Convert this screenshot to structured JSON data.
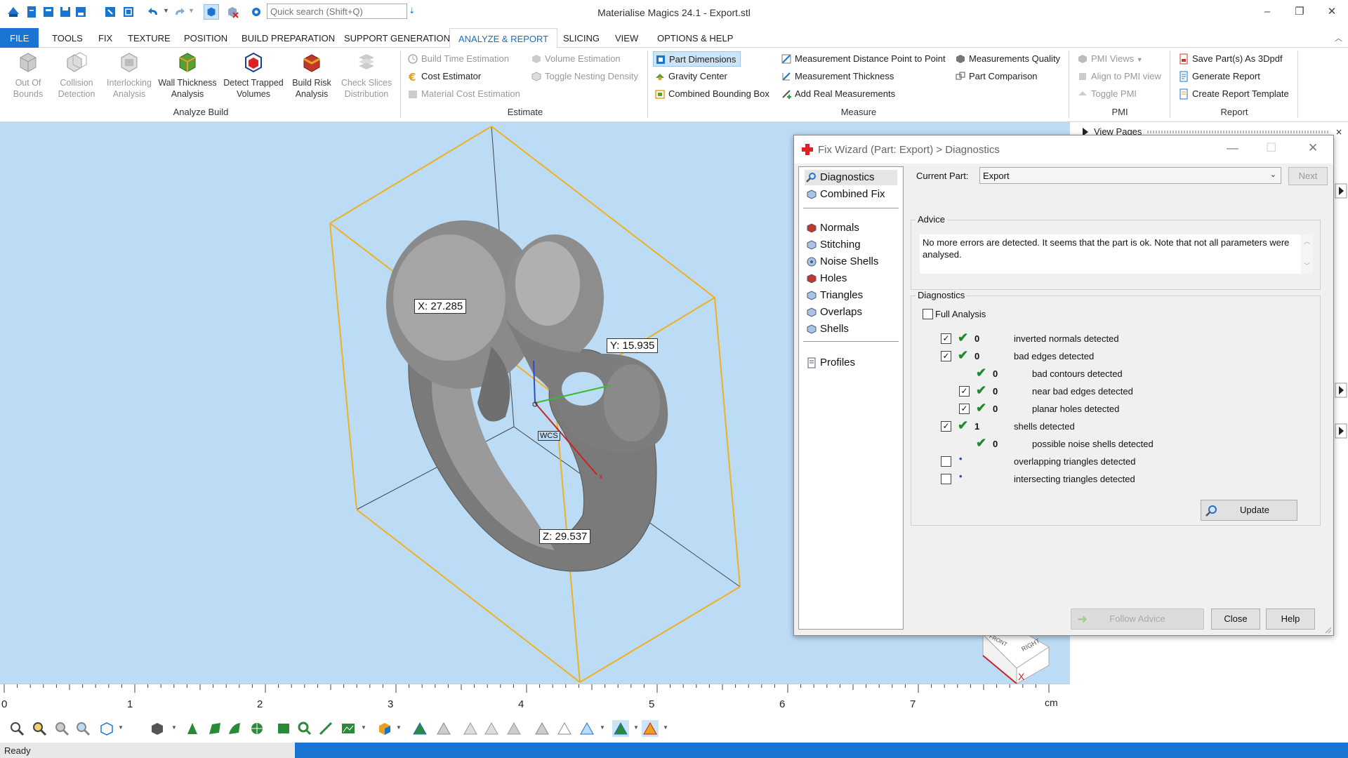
{
  "window": {
    "title": "Materialise Magics 24.1 - Export.stl",
    "search_placeholder": "Quick search (Shift+Q)",
    "minimize": "–",
    "restore": "❐",
    "close": "✕"
  },
  "menu": {
    "tabs": [
      "FILE",
      "TOOLS",
      "FIX",
      "TEXTURE",
      "POSITION",
      "BUILD PREPARATION",
      "SUPPORT GENERATION",
      "ANALYZE & REPORT",
      "SLICING",
      "VIEW",
      "OPTIONS & HELP"
    ],
    "active": "ANALYZE & REPORT"
  },
  "ribbon": {
    "analyze_build": {
      "label": "Analyze Build",
      "buttons": [
        {
          "line1": "Out Of",
          "line2": "Bounds",
          "enabled": false
        },
        {
          "line1": "Collision",
          "line2": "Detection",
          "enabled": false
        },
        {
          "line1": "Interlocking",
          "line2": "Analysis",
          "enabled": false
        },
        {
          "line1": "Wall Thickness",
          "line2": "Analysis",
          "enabled": true
        },
        {
          "line1": "Detect Trapped",
          "line2": "Volumes",
          "enabled": true
        },
        {
          "line1": "Build Risk",
          "line2": "Analysis",
          "enabled": true
        },
        {
          "line1": "Check Slices",
          "line2": "Distribution",
          "enabled": false
        }
      ]
    },
    "estimate": {
      "label": "Estimate",
      "col1": [
        "Build Time Estimation",
        "Cost Estimator",
        "Material Cost Estimation"
      ],
      "col2": [
        "Volume Estimation",
        "Toggle Nesting Density"
      ]
    },
    "measure": {
      "label": "Measure",
      "col1": [
        "Part Dimensions",
        "Gravity Center",
        "Combined Bounding Box"
      ],
      "col2": [
        "Measurement Distance Point to Point",
        "Measurement Thickness",
        "Add Real Measurements"
      ],
      "col3": [
        "Measurements Quality",
        "Part Comparison"
      ]
    },
    "pmi": {
      "label": "PMI",
      "items": [
        "PMI Views",
        "Align to PMI view",
        "Toggle PMI"
      ]
    },
    "report": {
      "label": "Report",
      "items": [
        "Save Part(s) As 3Dpdf",
        "Generate Report",
        "Create Report Template"
      ]
    }
  },
  "viewport": {
    "dim_x": "X: 27.285",
    "dim_y": "Y: 15.935",
    "dim_z": "Z: 29.537",
    "wcs": "WCS",
    "cube_front": "FRONT",
    "cube_right": "RIGHT",
    "axis_x": "X"
  },
  "ruler": {
    "ticks": [
      "0",
      "1",
      "2",
      "3",
      "4",
      "5",
      "6",
      "7"
    ],
    "unit": "cm"
  },
  "right_panel": {
    "view_pages": "View Pages"
  },
  "status": {
    "text": "Ready"
  },
  "dialog": {
    "title": "Fix Wizard (Part: Export) > Diagnostics",
    "nav": {
      "top": [
        "Diagnostics",
        "Combined Fix"
      ],
      "middle": [
        "Normals",
        "Stitching",
        "Noise Shells",
        "Holes",
        "Triangles",
        "Overlaps",
        "Shells"
      ],
      "bottom": [
        "Profiles"
      ]
    },
    "current_part_label": "Current Part:",
    "current_part_value": "Export",
    "next": "Next",
    "advice_legend": "Advice",
    "advice_text": "No more errors are detected. It seems that the part is ok. Note that not all parameters were analysed.",
    "diagnostics_legend": "Diagnostics",
    "full_analysis": "Full Analysis",
    "rows": [
      {
        "checked": true,
        "status": "ok",
        "count": "0",
        "label": "inverted normals detected",
        "indent": 0,
        "has_check": true
      },
      {
        "checked": true,
        "status": "ok",
        "count": "0",
        "label": "bad edges detected",
        "indent": 0,
        "has_check": true
      },
      {
        "checked": false,
        "status": "ok",
        "count": "0",
        "label": "bad contours detected",
        "indent": 1,
        "has_check": false
      },
      {
        "checked": true,
        "status": "ok",
        "count": "0",
        "label": "near bad edges detected",
        "indent": 1,
        "has_check": true
      },
      {
        "checked": true,
        "status": "ok",
        "count": "0",
        "label": "planar holes detected",
        "indent": 1,
        "has_check": true
      },
      {
        "checked": true,
        "status": "ok",
        "count": "1",
        "label": "shells detected",
        "indent": 0,
        "has_check": true
      },
      {
        "checked": false,
        "status": "ok",
        "count": "0",
        "label": "possible noise shells detected",
        "indent": 1,
        "has_check": false
      },
      {
        "checked": false,
        "status": "dot",
        "count": "",
        "label": "overlapping triangles detected",
        "indent": 0,
        "has_check": true
      },
      {
        "checked": false,
        "status": "dot",
        "count": "",
        "label": "intersecting triangles detected",
        "indent": 0,
        "has_check": true
      }
    ],
    "update": "Update",
    "follow_advice": "Follow Advice",
    "close": "Close",
    "help": "Help"
  }
}
